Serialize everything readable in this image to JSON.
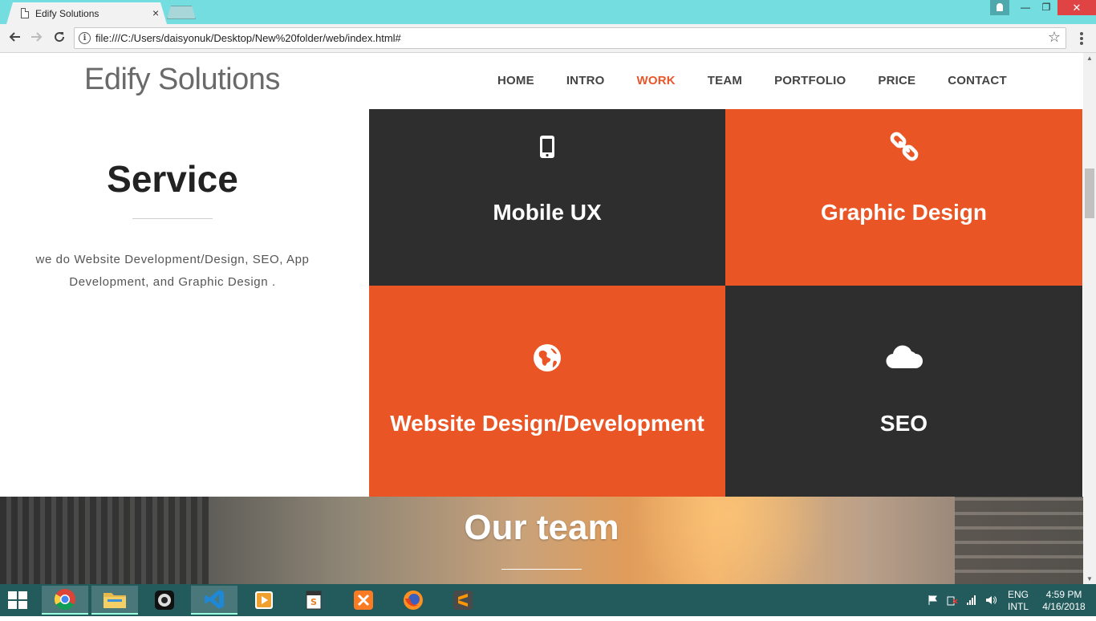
{
  "browser": {
    "tab_title": "Edify Solutions",
    "tab_close": "×",
    "url": "file:///C:/Users/daisyonuk/Desktop/New%20folder/web/index.html#",
    "window_controls": {
      "minimize": "—",
      "maximize": "❐",
      "close": "✕"
    }
  },
  "site": {
    "brand": "Edify Solutions",
    "nav": [
      {
        "label": "HOME",
        "active": false
      },
      {
        "label": "INTRO",
        "active": false
      },
      {
        "label": "WORK",
        "active": true
      },
      {
        "label": "TEAM",
        "active": false
      },
      {
        "label": "PORTFOLIO",
        "active": false
      },
      {
        "label": "PRICE",
        "active": false
      },
      {
        "label": "CONTACT",
        "active": false
      }
    ],
    "service": {
      "title": "Service",
      "description": "we do Website Development/Design, SEO, App Development, and Graphic Design ."
    },
    "tiles": [
      {
        "title": "Mobile UX",
        "icon": "mobile-icon",
        "color": "#2e2e2e"
      },
      {
        "title": "Graphic Design",
        "icon": "link-icon",
        "color": "#e95524"
      },
      {
        "title": "Website Design/Development",
        "icon": "globe-icon",
        "color": "#e95524"
      },
      {
        "title": "SEO",
        "icon": "cloud-icon",
        "color": "#2e2e2e"
      }
    ],
    "team": {
      "title": "Our team"
    },
    "accent_color": "#e8572a"
  },
  "taskbar": {
    "apps": [
      "chrome-icon",
      "file-explorer-icon",
      "webcam-icon",
      "visual-studio-code-icon",
      "media-player-icon",
      "notepad-icon",
      "xampp-icon",
      "firefox-icon",
      "sublime-text-icon"
    ],
    "language": {
      "line1": "ENG",
      "line2": "INTL"
    },
    "clock": {
      "time": "4:59 PM",
      "date": "4/16/2018"
    }
  }
}
